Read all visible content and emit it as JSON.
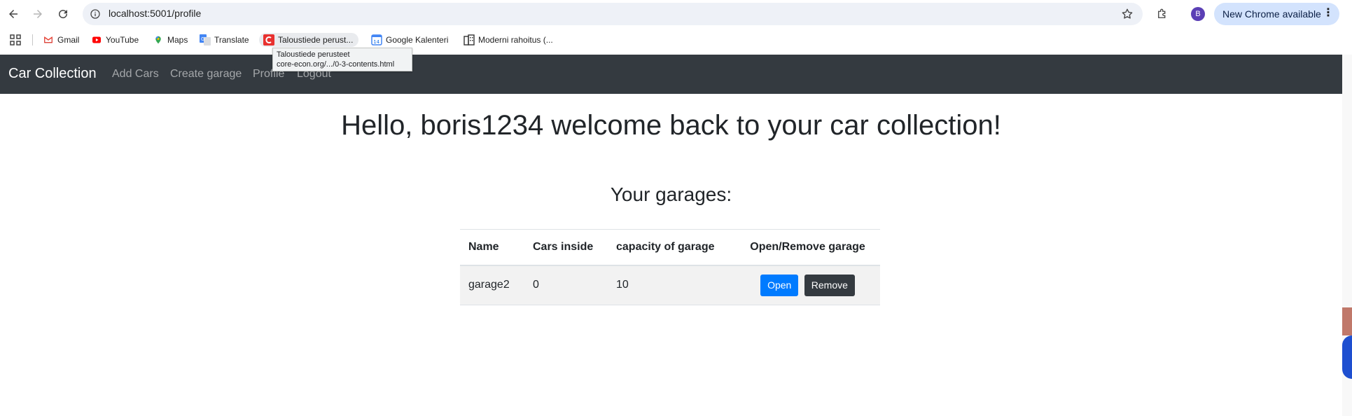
{
  "browser": {
    "url": "localhost:5001/profile",
    "update_label": "New Chrome available",
    "avatar_letter": "B"
  },
  "bookmarks": [
    {
      "label": "Gmail",
      "icon": "gmail-icon"
    },
    {
      "label": "YouTube",
      "icon": "youtube-icon"
    },
    {
      "label": "Maps",
      "icon": "maps-icon"
    },
    {
      "label": "Translate",
      "icon": "translate-icon"
    },
    {
      "label": "Taloustiede perust...",
      "icon": "core-econ-icon"
    },
    {
      "label": "Google Kalenteri",
      "icon": "calendar-icon"
    },
    {
      "label": "Moderni rahoitus (...",
      "icon": "building-icon"
    }
  ],
  "tooltip": {
    "line1": "Taloustiede perusteet",
    "line2": "core-econ.org/.../0-3-contents.html"
  },
  "navbar": {
    "brand": "Car Collection",
    "links": [
      "Add Cars",
      "Create garage",
      "Profile",
      "Logout"
    ]
  },
  "main": {
    "welcome": "Hello, boris1234 welcome back to your car collection!",
    "garages_title": "Your garages:",
    "table": {
      "headers": [
        "Name",
        "Cars inside",
        "capacity of garage",
        "Open/Remove garage"
      ],
      "rows": [
        {
          "name": "garage2",
          "cars_inside": "0",
          "capacity": "10",
          "open_label": "Open",
          "remove_label": "Remove"
        }
      ]
    }
  },
  "colors": {
    "navbar_bg": "#343a40",
    "primary": "#007bff",
    "dark": "#343a40"
  }
}
